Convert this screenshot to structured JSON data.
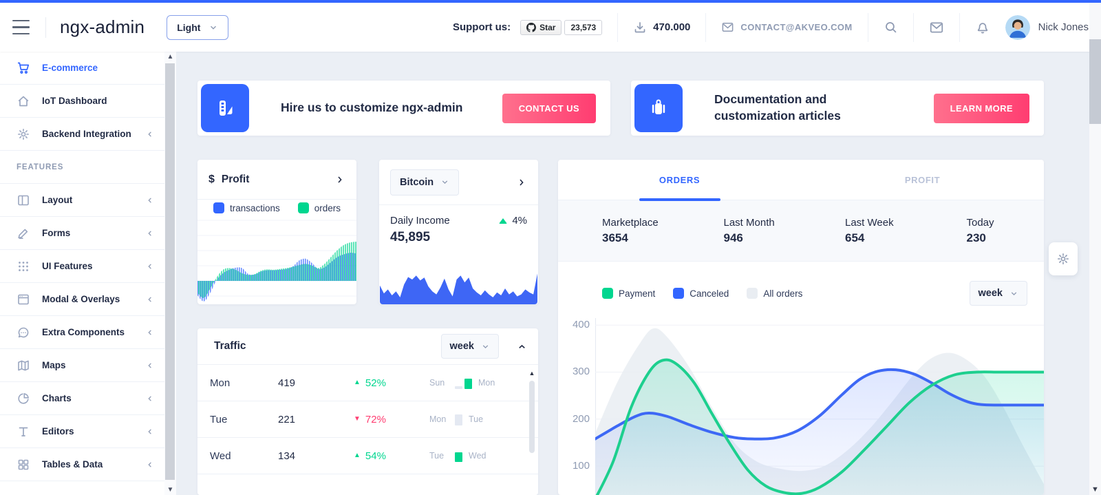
{
  "theme": {
    "primary": "#3366ff",
    "success": "#00d68f",
    "danger": "#ff3d71",
    "text_dark": "#222b45",
    "text_hint": "#8f9bb3",
    "all_orders_gray": "#e9edf2"
  },
  "header": {
    "logo": "ngx-admin",
    "theme_select": {
      "value": "Light"
    },
    "support_label": "Support us:",
    "github": {
      "star_label": "Star",
      "count": "23,573"
    },
    "downloads": "470.000",
    "contact_email": "CONTACT@AKVEO.COM",
    "user": {
      "name": "Nick Jones"
    },
    "icons": [
      "menu-icon",
      "github-icon",
      "download-icon",
      "email-icon",
      "search-icon",
      "mail-icon",
      "bell-icon"
    ]
  },
  "sidebar": {
    "items": [
      {
        "label": "E-commerce",
        "icon": "cart-icon",
        "active": true,
        "expandable": false
      },
      {
        "label": "IoT Dashboard",
        "icon": "home-icon",
        "expandable": false
      },
      {
        "label": "Backend Integration",
        "icon": "gear-icon",
        "expandable": true
      },
      {
        "group": "FEATURES"
      },
      {
        "label": "Layout",
        "icon": "layout-icon",
        "expandable": true
      },
      {
        "label": "Forms",
        "icon": "edit-icon",
        "expandable": true
      },
      {
        "label": "UI Features",
        "icon": "keypad-icon",
        "expandable": true
      },
      {
        "label": "Modal & Overlays",
        "icon": "browser-icon",
        "expandable": true
      },
      {
        "label": "Extra Components",
        "icon": "message-circle-icon",
        "expandable": true
      },
      {
        "label": "Maps",
        "icon": "map-icon",
        "expandable": true
      },
      {
        "label": "Charts",
        "icon": "pie-chart-icon",
        "expandable": true
      },
      {
        "label": "Editors",
        "icon": "text-icon",
        "expandable": true
      },
      {
        "label": "Tables & Data",
        "icon": "grid-icon",
        "expandable": true
      }
    ]
  },
  "banners": [
    {
      "title": "Hire us to customize ngx-admin",
      "button_label": "CONTACT US",
      "icon": "color-swatch-icon"
    },
    {
      "title": "Documentation and customization articles",
      "button_label": "LEARN MORE",
      "icon": "briefcase-icon"
    }
  ],
  "profit_card": {
    "title": "Profit",
    "currency_symbol": "$",
    "legend": [
      {
        "label": "transactions",
        "color": "#3366ff"
      },
      {
        "label": "orders",
        "color": "#00d68f"
      }
    ]
  },
  "bitcoin_card": {
    "select_value": "Bitcoin",
    "metric_label": "Daily Income",
    "metric_value": "45,895",
    "delta": "4%",
    "delta_direction": "up"
  },
  "orders_card": {
    "tabs": [
      {
        "label": "ORDERS",
        "active": true
      },
      {
        "label": "PROFIT",
        "active": false
      }
    ],
    "stats": [
      {
        "label": "Marketplace",
        "value": "3654"
      },
      {
        "label": "Last Month",
        "value": "946"
      },
      {
        "label": "Last Week",
        "value": "654"
      },
      {
        "label": "Today",
        "value": "230"
      }
    ],
    "legend": [
      {
        "label": "Payment",
        "color": "#00d68f"
      },
      {
        "label": "Canceled",
        "color": "#3366ff"
      },
      {
        "label": "All orders",
        "color": "#e9edf2"
      }
    ],
    "period_select": "week"
  },
  "traffic_card": {
    "title": "Traffic",
    "period_select": "week",
    "rows": [
      {
        "day": "Mon",
        "value": "419",
        "delta": "52%",
        "direction": "up",
        "compare_from": "Sun",
        "compare_to": "Mon",
        "bars": [
          {
            "color": "#e4e9f2",
            "h": 4
          },
          {
            "color": "#00d68f",
            "h": 15
          }
        ]
      },
      {
        "day": "Tue",
        "value": "221",
        "delta": "72%",
        "direction": "down",
        "compare_from": "Mon",
        "compare_to": "Tue",
        "bars": [
          {
            "color": "#e4e9f2",
            "h": 16
          }
        ]
      },
      {
        "day": "Wed",
        "value": "134",
        "delta": "54%",
        "direction": "up",
        "compare_from": "Tue",
        "compare_to": "Wed",
        "bars": [
          {
            "color": "#00d68f",
            "h": 14
          }
        ]
      }
    ]
  },
  "chart_data": [
    {
      "id": "profit",
      "type": "area",
      "style": "vertical-striped",
      "title": "Profit",
      "grid": true,
      "baseline": 0,
      "series": [
        {
          "name": "transactions",
          "color": "#3366ff",
          "points": [
            [
              0,
              -34
            ],
            [
              4,
              -48
            ],
            [
              8,
              -28
            ],
            [
              12,
              2
            ],
            [
              16,
              18
            ],
            [
              20,
              26
            ],
            [
              24,
              31
            ],
            [
              28,
              30
            ],
            [
              32,
              16
            ],
            [
              36,
              15
            ],
            [
              40,
              22
            ],
            [
              44,
              25
            ],
            [
              48,
              25
            ],
            [
              52,
              26
            ],
            [
              56,
              28
            ],
            [
              60,
              34
            ],
            [
              64,
              48
            ],
            [
              68,
              52
            ],
            [
              72,
              42
            ],
            [
              76,
              28
            ],
            [
              80,
              32
            ],
            [
              84,
              44
            ],
            [
              88,
              56
            ],
            [
              92,
              62
            ],
            [
              96,
              66
            ],
            [
              100,
              64
            ]
          ]
        },
        {
          "name": "orders",
          "color": "#00d68f",
          "points": [
            [
              0,
              -28
            ],
            [
              4,
              -40
            ],
            [
              8,
              -18
            ],
            [
              12,
              8
            ],
            [
              16,
              26
            ],
            [
              20,
              30
            ],
            [
              24,
              26
            ],
            [
              28,
              18
            ],
            [
              32,
              14
            ],
            [
              36,
              16
            ],
            [
              40,
              24
            ],
            [
              44,
              27
            ],
            [
              48,
              26
            ],
            [
              52,
              28
            ],
            [
              56,
              30
            ],
            [
              60,
              33
            ],
            [
              64,
              37
            ],
            [
              68,
              40
            ],
            [
              72,
              36
            ],
            [
              76,
              30
            ],
            [
              80,
              40
            ],
            [
              84,
              56
            ],
            [
              88,
              72
            ],
            [
              92,
              84
            ],
            [
              96,
              90
            ],
            [
              100,
              92
            ]
          ]
        }
      ]
    },
    {
      "id": "bitcoin",
      "type": "area",
      "title": "Daily Income",
      "color": "#3e66f5",
      "values": [
        38,
        22,
        30,
        18,
        26,
        14,
        40,
        55,
        50,
        58,
        48,
        54,
        36,
        26,
        20,
        34,
        52,
        30,
        16,
        50,
        58,
        44,
        54,
        32,
        24,
        18,
        28,
        20,
        14,
        24,
        18,
        32,
        20,
        26,
        16,
        20,
        30,
        24,
        20,
        62
      ]
    },
    {
      "id": "orders",
      "type": "line",
      "yticks": [
        "400",
        "300",
        "200",
        "100"
      ],
      "ylim": [
        37,
        415
      ],
      "grid": true,
      "legend_position": "top-left",
      "series": [
        {
          "name": "All orders",
          "kind": "area",
          "color": "#e9edf2",
          "points": [
            [
              0,
              170
            ],
            [
              5,
              280
            ],
            [
              10,
              362
            ],
            [
              13,
              393
            ],
            [
              16,
              375
            ],
            [
              21,
              310
            ],
            [
              26,
              225
            ],
            [
              31,
              150
            ],
            [
              36,
              110
            ],
            [
              41,
              95
            ],
            [
              46,
              90
            ],
            [
              51,
              100
            ],
            [
              56,
              132
            ],
            [
              61,
              178
            ],
            [
              66,
              235
            ],
            [
              71,
              295
            ],
            [
              75,
              330
            ],
            [
              79,
              341
            ],
            [
              83,
              325
            ],
            [
              87,
              288
            ],
            [
              91,
              225
            ],
            [
              95,
              150
            ],
            [
              100,
              62
            ]
          ]
        },
        {
          "name": "Canceled",
          "kind": "line",
          "color": "#3d68f5",
          "points": [
            [
              0,
              158
            ],
            [
              5,
              186
            ],
            [
              9,
              206
            ],
            [
              12,
              213
            ],
            [
              16,
              206
            ],
            [
              21,
              188
            ],
            [
              26,
              172
            ],
            [
              31,
              161
            ],
            [
              35,
              158
            ],
            [
              40,
              160
            ],
            [
              45,
              175
            ],
            [
              50,
              207
            ],
            [
              55,
              252
            ],
            [
              59,
              285
            ],
            [
              63,
              302
            ],
            [
              67,
              305
            ],
            [
              71,
              296
            ],
            [
              75,
              277
            ],
            [
              79,
              254
            ],
            [
              83,
              237
            ],
            [
              86,
              231
            ],
            [
              90,
              230
            ],
            [
              95,
              230
            ],
            [
              100,
              230
            ]
          ]
        },
        {
          "name": "Payment",
          "kind": "line",
          "color": "#1dcf8e",
          "points": [
            [
              0,
              30
            ],
            [
              4,
              110
            ],
            [
              8,
              225
            ],
            [
              12,
              300
            ],
            [
              15,
              325
            ],
            [
              18,
              318
            ],
            [
              22,
              278
            ],
            [
              26,
              212
            ],
            [
              30,
              148
            ],
            [
              34,
              92
            ],
            [
              38,
              58
            ],
            [
              42,
              44
            ],
            [
              46,
              42
            ],
            [
              50,
              55
            ],
            [
              55,
              88
            ],
            [
              60,
              135
            ],
            [
              65,
              185
            ],
            [
              70,
              235
            ],
            [
              75,
              272
            ],
            [
              80,
              294
            ],
            [
              85,
              300
            ],
            [
              90,
              300
            ],
            [
              95,
              300
            ],
            [
              100,
              300
            ]
          ]
        }
      ]
    }
  ]
}
